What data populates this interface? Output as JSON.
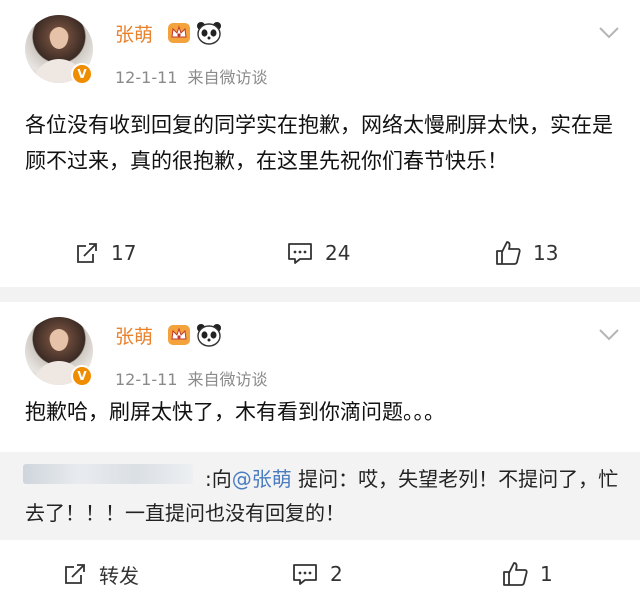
{
  "posts": [
    {
      "author": "张萌",
      "date": "12-1-11",
      "source": "来自微访谈",
      "text": "各位没有收到回复的同学实在抱歉，网络太慢刷屏太快，实在是顾不过来，真的很抱歉，在这里先祝你们春节快乐！",
      "actions": {
        "repost": "17",
        "comment": "24",
        "like": "13"
      }
    },
    {
      "author": "张萌",
      "date": "12-1-11",
      "source": "来自微访谈",
      "text": "抱歉哈，刷屏太快了，木有看到你滴问题。。。",
      "quoted": {
        "prefix": ":向",
        "mention": "@张萌",
        "text": " 提问：哎，失望老列！不提问了，忙去了！！！一直提问也没有回复的！"
      },
      "actions": {
        "repost": "转发",
        "comment": "2",
        "like": "1"
      }
    }
  ],
  "colors": {
    "name": "#e8822d",
    "meta": "#8a8a8a",
    "mention": "#4a7cc0",
    "vbadge": "#f08c00"
  },
  "icons": [
    "vip-crown-icon",
    "panda-icon",
    "chevron-down-icon",
    "repost-icon",
    "comment-icon",
    "like-icon",
    "verified-badge-icon"
  ]
}
